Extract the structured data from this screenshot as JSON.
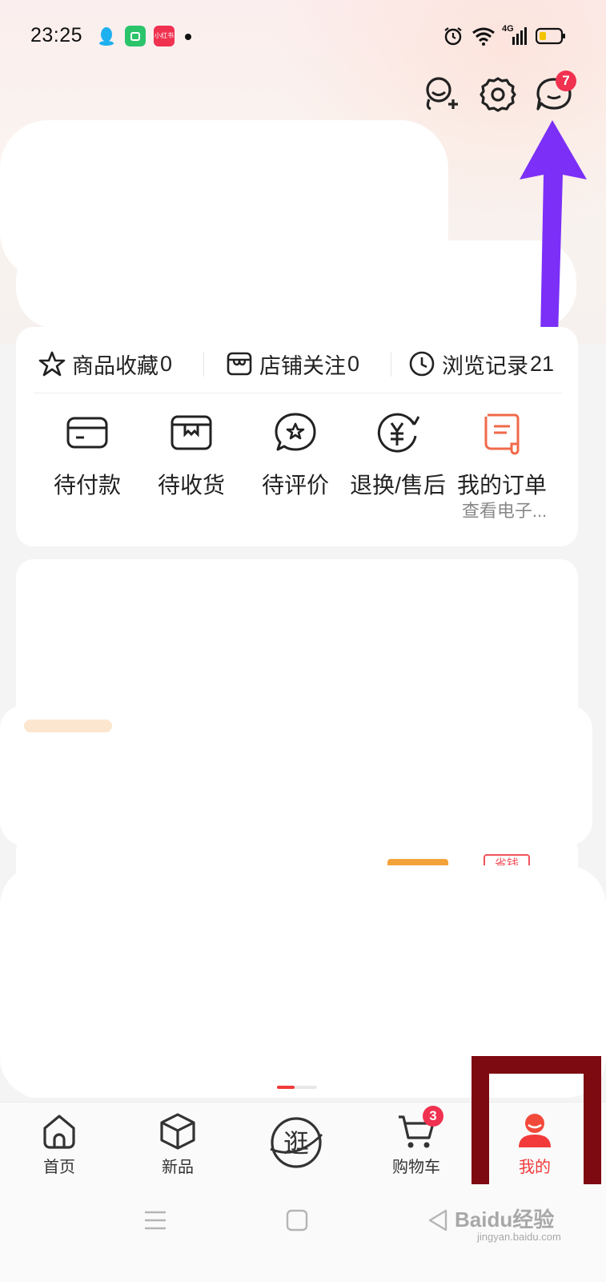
{
  "status_bar": {
    "time": "23:25",
    "network": "4G",
    "app_icons": [
      "qq-icon",
      "wechat-shop-icon",
      "xiaohongshu-icon"
    ],
    "xiaohongshu_text": "小红书"
  },
  "header": {
    "message_badge": "7"
  },
  "quick_links": [
    {
      "label": "商品收藏",
      "count": "0",
      "icon": "star-icon"
    },
    {
      "label": "店铺关注",
      "count": "0",
      "icon": "store-icon"
    },
    {
      "label": "浏览记录",
      "count": "21",
      "icon": "clock-icon"
    }
  ],
  "orders": {
    "items": [
      {
        "label": "待付款",
        "icon": "wallet-icon"
      },
      {
        "label": "待收货",
        "icon": "package-icon"
      },
      {
        "label": "待评价",
        "icon": "review-icon"
      },
      {
        "label": "退换/售后",
        "icon": "refund-icon"
      },
      {
        "label": "我的订单",
        "icon": "order-list-icon"
      }
    ],
    "sub_text": "查看电子..."
  },
  "promo_tag": "省钱",
  "bottom_nav": {
    "items": [
      {
        "label": "首页",
        "icon": "home-icon"
      },
      {
        "label": "新品",
        "icon": "cube-icon"
      },
      {
        "label": "逛",
        "icon": "browse-icon"
      },
      {
        "label": "购物车",
        "icon": "cart-icon"
      },
      {
        "label": "我的",
        "icon": "profile-icon"
      }
    ],
    "cart_badge": "3",
    "active": "我的"
  },
  "watermark": {
    "main": "Baidu经验",
    "sub": "jingyan.baidu.com"
  },
  "colors": {
    "accent": "#f23a3a",
    "badge": "#f0314f",
    "annotation_arrow": "#7b2ff7",
    "annotation_box": "#7d0a10"
  }
}
